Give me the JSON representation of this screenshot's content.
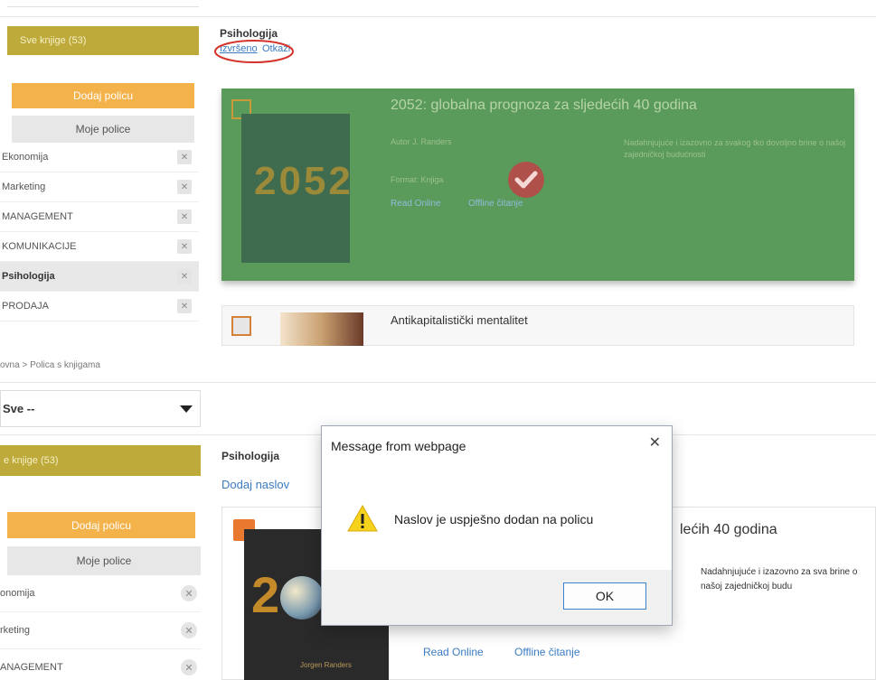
{
  "top": {
    "all_books": "Sve knjige (53)",
    "add_shelf": "Dodaj policu",
    "my_shelves": "Moje police",
    "shelves": [
      "Ekonomija",
      "Marketing",
      "MANAGEMENT",
      "KOMUNIKACIJE",
      "Psihologija",
      "PRODAJA"
    ],
    "active_shelf": "Psihologija",
    "section_title": "Psihologija",
    "done_link": "Izvršeno",
    "cancel_link": "Otkaži",
    "book1": {
      "title": "2052: globalna prognoza za sljedećih 40 godina",
      "author": "Autor J. Randers",
      "format": "Format: Knjiga",
      "read_online": "Read Online",
      "offline": "Offline čitanje",
      "description": "Nadahnjujuće i izazovno za svakog tko dovoljno brine o našoj zajedničkoj budućnosti",
      "cover_text": "2052"
    },
    "book2": {
      "title": "Antikapitalistički mentalitet"
    }
  },
  "bottom": {
    "breadcrumb": "ovna > Polica s knjigama",
    "select_value": "Sve --",
    "all_books": "e knjige (53)",
    "add_shelf": "Dodaj policu",
    "my_shelves": "Moje police",
    "shelves": [
      "onomija",
      "rketing",
      "ANAGEMENT"
    ],
    "section_title": "Psihologija",
    "add_title_link": "Dodaj naslov",
    "book_title_fragment": "lećih 40 godina",
    "description": "Nadahnjujuće i izazovno za sva brine o našoj zajedničkoj budu",
    "read_online": "Read Online",
    "offline": "Offline čitanje",
    "cover_text": "2",
    "cover_author": "Jorgen Randers"
  },
  "dialog": {
    "title": "Message from webpage",
    "message": "Naslov je uspješno dodan na policu",
    "ok": "OK",
    "close_glyph": "✕"
  },
  "colors": {
    "olive": "#bdaa3a",
    "orange": "#f4b24a",
    "card_green": "#5a9a5a",
    "checkmark": "#b0504a",
    "highlight_circle": "#d4322a",
    "link": "#3a7bc2"
  }
}
